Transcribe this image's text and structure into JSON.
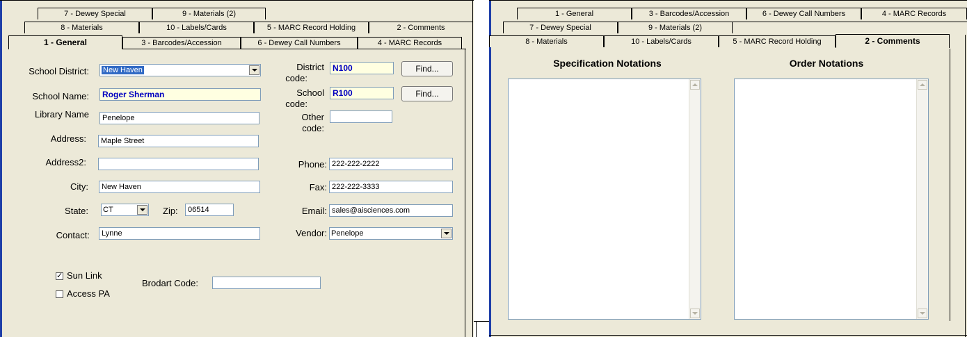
{
  "left": {
    "tab_rows": {
      "row1": [
        "7 - Dewey Special",
        "9 - Materials (2)"
      ],
      "row2": [
        "8 - Materials",
        "10 - Labels/Cards",
        "5 - MARC Record Holding",
        "2 - Comments"
      ],
      "row3": [
        "1 - General",
        "3 - Barcodes/Accession",
        "6 - Dewey Call Numbers",
        "4 - MARC Records"
      ]
    },
    "form": {
      "school_district_label": "School District:",
      "school_district_value": "New Haven",
      "school_name_label": "School Name:",
      "school_name_value": "Roger Sherman",
      "library_name_label": "Library Name",
      "library_name_value": "Penelope",
      "address_label": "Address:",
      "address_value": "Maple Street",
      "address2_label": "Address2:",
      "address2_value": "",
      "city_label": "City:",
      "city_value": "New Haven",
      "state_label": "State:",
      "state_value": "CT",
      "zip_label": "Zip:",
      "zip_value": "06514",
      "contact_label": "Contact:",
      "contact_value": "Lynne",
      "district_code_label_1": "District",
      "district_code_label_2": "code:",
      "district_code_value": "N100",
      "school_code_label_1": "School",
      "school_code_label_2": "code:",
      "school_code_value": "R100",
      "other_code_label_1": "Other",
      "other_code_label_2": "code:",
      "other_code_value": "",
      "find_label": "Find...",
      "phone_label": "Phone:",
      "phone_value": "222-222-2222",
      "fax_label": "Fax:",
      "fax_value": "222-222-3333",
      "email_label": "Email:",
      "email_value": "sales@aisciences.com",
      "vendor_label": "Vendor:",
      "vendor_value": "Penelope",
      "sun_link_label": "Sun Link",
      "sun_link_checked": true,
      "access_pa_label": "Access PA",
      "access_pa_checked": false,
      "brodart_label": "Brodart Code:",
      "brodart_value": ""
    }
  },
  "right": {
    "tab_rows": {
      "row1": [
        "1 - General",
        "3 - Barcodes/Accession",
        "6 - Dewey Call Numbers",
        "4 - MARC Records"
      ],
      "row2": [
        "7 - Dewey Special",
        "9 - Materials (2)"
      ],
      "row3": [
        "8 - Materials",
        "10 - Labels/Cards",
        "5 - MARC Record Holding",
        "2 - Comments"
      ]
    },
    "spec_heading": "Specification Notations",
    "order_heading": "Order Notations"
  },
  "colors": {
    "panel": "#ece9d8",
    "highlight": "#316ac5",
    "code_field_bg": "#ffffe1",
    "code_text": "#0000c0"
  }
}
